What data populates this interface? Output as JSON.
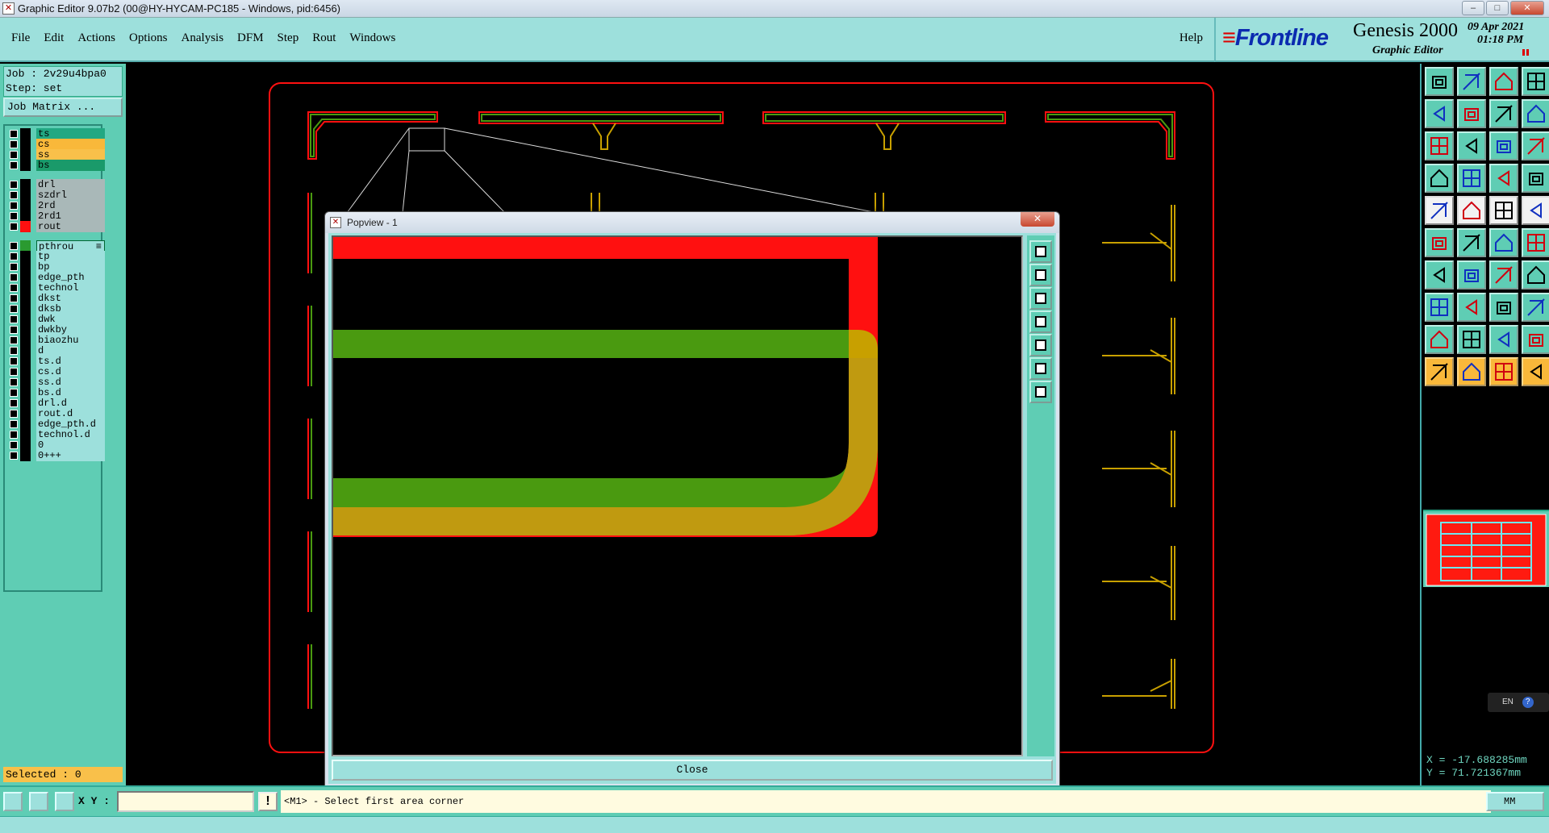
{
  "window": {
    "title": "Graphic Editor 9.07b2 (00@HY-HYCAM-PC185 - Windows, pid:6456)",
    "minimize": "–",
    "maximize": "□",
    "close": "✕"
  },
  "menu": {
    "items": [
      "File",
      "Edit",
      "Actions",
      "Options",
      "Analysis",
      "DFM",
      "Step",
      "Rout",
      "Windows"
    ],
    "help": "Help"
  },
  "brand": {
    "logo": "Frontline",
    "product": "Genesis 2000",
    "subtitle": "Graphic Editor",
    "date": "09 Apr 2021",
    "time": "01:18 PM"
  },
  "job": {
    "job_line": "Job : 2v29u4bpa0",
    "step_line": "Step: set",
    "matrix_button": "Job Matrix ..."
  },
  "layers": [
    {
      "name": "ts",
      "style": "ts"
    },
    {
      "name": "cs",
      "style": "cs"
    },
    {
      "name": "ss",
      "style": "ss"
    },
    {
      "name": "bs",
      "style": "bs"
    },
    {
      "name": "drl",
      "style": "grey"
    },
    {
      "name": "szdrl",
      "style": "grey"
    },
    {
      "name": "2rd",
      "style": "grey"
    },
    {
      "name": "2rd1",
      "style": "grey"
    },
    {
      "name": "rout",
      "style": "grey",
      "swatch": "#ff1010"
    },
    {
      "name": "pthrou",
      "style": "work",
      "swatch": "#2a9a30",
      "marker": "≡"
    },
    {
      "name": "tp",
      "style": ""
    },
    {
      "name": "bp",
      "style": ""
    },
    {
      "name": "edge_pth",
      "style": ""
    },
    {
      "name": "technol",
      "style": ""
    },
    {
      "name": "dkst",
      "style": ""
    },
    {
      "name": "dksb",
      "style": ""
    },
    {
      "name": "dwk",
      "style": ""
    },
    {
      "name": "dwkby",
      "style": ""
    },
    {
      "name": "biaozhu",
      "style": ""
    },
    {
      "name": "d",
      "style": ""
    },
    {
      "name": "ts.d",
      "style": ""
    },
    {
      "name": "cs.d",
      "style": ""
    },
    {
      "name": "ss.d",
      "style": ""
    },
    {
      "name": "bs.d",
      "style": ""
    },
    {
      "name": "drl.d",
      "style": ""
    },
    {
      "name": "rout.d",
      "style": ""
    },
    {
      "name": "edge_pth.d",
      "style": ""
    },
    {
      "name": "technol.d",
      "style": ""
    },
    {
      "name": "0",
      "style": ""
    },
    {
      "name": "0+++",
      "style": ""
    }
  ],
  "selected": "Selected : 0",
  "popview": {
    "title": "Popview - 1",
    "close_label": "Close",
    "close_x": "✕"
  },
  "coords": {
    "x": "X = -17.688285mm",
    "y": "Y = 71.721367mm"
  },
  "language": "EN",
  "bottom": {
    "xy_label": "X Y :",
    "xy_value": "",
    "bang": "!",
    "message": "<M1> - Select first area corner",
    "units": "MM"
  },
  "colors": {
    "accent_teal": "#5fcdb4",
    "light_teal": "#9de0dc",
    "rout_red": "#ff1010",
    "trace_green": "#4a9a10",
    "trace_gold": "#c8a000"
  }
}
